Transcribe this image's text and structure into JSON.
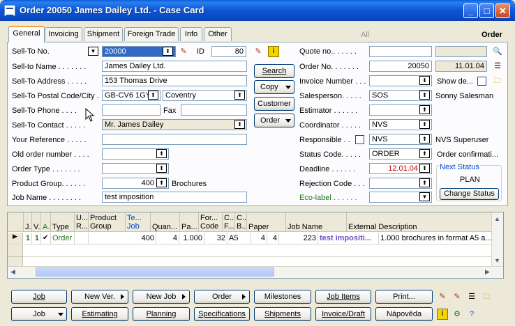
{
  "window": {
    "title": "Order 20050 James Dailey Ltd. - Case Card"
  },
  "tabs": [
    "General",
    "Invoicing",
    "Shipment",
    "Foreign Trade",
    "Info",
    "Other"
  ],
  "hidden_tab": "All",
  "form_heading": "Order",
  "left": {
    "sell_to_no": {
      "label": "Sell-To No.",
      "value": "20000"
    },
    "id": {
      "label": "ID",
      "value": "80"
    },
    "sell_to_name": {
      "label": "Sell-to Name . . . . . . .",
      "value": "James Dailey Ltd."
    },
    "sell_to_address": {
      "label": "Sell-To Address . . . . .",
      "value": "153 Thomas Drive"
    },
    "postal_city": {
      "label": "Sell-To Postal Code/City .",
      "postal": "GB-CV6 1GY",
      "city": "Coventry"
    },
    "phone": {
      "label": "Sell-To Phone . . . .",
      "value": "",
      "fax_label": "Fax",
      "fax": ""
    },
    "contact": {
      "label": "Sell-To Contact . . . . .",
      "value": "Mr. James Dailey"
    },
    "reference": {
      "label": "Your Reference . . . . .",
      "value": ""
    },
    "old_order": {
      "label": "Old order number . . . .",
      "value": ""
    },
    "order_type": {
      "label": "Order Type . . . . . . .",
      "value": ""
    },
    "product_group": {
      "label": "Product Group. . . . . .",
      "value": "400",
      "desc": "Brochures"
    },
    "job_name": {
      "label": "Job Name . . . . . . . .",
      "value": "test imposition"
    }
  },
  "mid_buttons": {
    "search": "Search",
    "copy": "Copy",
    "customer": "Customer",
    "order": "Order"
  },
  "right": {
    "quote_no": {
      "label": "Quote no.. . . . . .",
      "value": "",
      "extra": ""
    },
    "order_no": {
      "label": "Order No. . . . . . .",
      "value": "20050",
      "date": "11.01.04"
    },
    "invoice_no": {
      "label": "Invoice Number . . .",
      "value": "",
      "show_label": "Show de..."
    },
    "salesperson": {
      "label": "Salesperson. . . . .",
      "value": "SOS",
      "name": "Sonny Salesman"
    },
    "estimator": {
      "label": "Estimator . . . . . .",
      "value": ""
    },
    "coordinator": {
      "label": "Coordinator . . . . .",
      "value": "NVS"
    },
    "responsible": {
      "label": "Responsible . .",
      "value": "NVS",
      "name": "NVS Superuser"
    },
    "status_code": {
      "label": "Status Code. . . . .",
      "value": "ORDER",
      "desc": "Order confirmati..."
    },
    "deadline": {
      "label": "Deadline . . . . . .",
      "value": "12.01.04"
    },
    "rejection": {
      "label": "Rejection Code . . .",
      "value": ""
    },
    "eco_label": {
      "label": "Eco-label . . . . . .",
      "value": ""
    },
    "next_status": {
      "title": "Next Status",
      "value": "PLAN",
      "button": "Change Status"
    }
  },
  "grid": {
    "headers": [
      "J...",
      "V...",
      "A...",
      "Type",
      "U... R...",
      "Product Group",
      "Te... Job",
      "Quan...",
      "Pa...",
      "For... Code",
      "C... F...",
      "C... B...",
      "Paper",
      "Job Name",
      "External Description"
    ],
    "rows": [
      [
        "1",
        "1",
        "✔",
        "Order",
        "",
        "400",
        "4",
        "1.000",
        "32",
        "A5",
        "4",
        "4",
        "223",
        "test impositi...",
        "1.000 brochures in format A5 a..."
      ]
    ]
  },
  "bottom_row1": [
    "Job",
    "New Ver.",
    "New Job",
    "Order",
    "Milestones",
    "Job Items",
    "Print..."
  ],
  "bottom_row2": [
    "Job",
    "Estimating",
    "Planning",
    "Specifications",
    "Shipments",
    "Invoice/Draft",
    "Nápověda"
  ],
  "colors": {
    "titlebar": "#0a5fd8",
    "accent_tab": "#f2a33b",
    "deadline": "#c00000",
    "selection": "#316ac5"
  }
}
